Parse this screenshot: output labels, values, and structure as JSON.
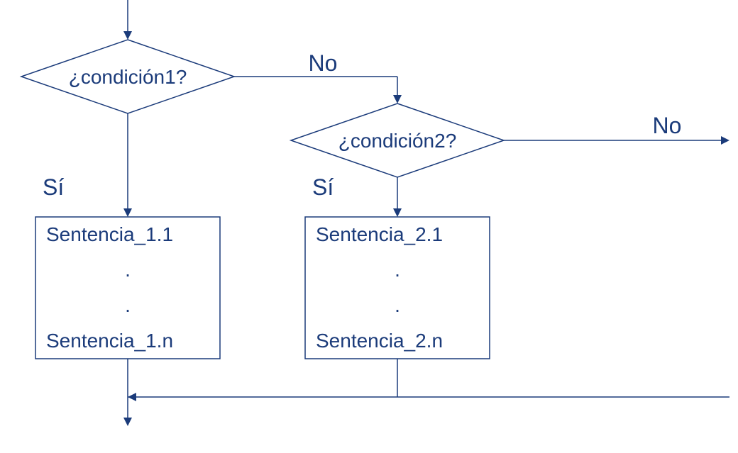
{
  "diagram": {
    "type": "flowchart",
    "decision1": {
      "label": "¿condición1?",
      "yes": "Sí",
      "no": "No"
    },
    "decision2": {
      "label": "¿condición2?",
      "yes": "Sí",
      "no": "No"
    },
    "process1": {
      "line1": "Sentencia_1.1",
      "line2": ".",
      "line3": ".",
      "line4": "Sentencia_1.n"
    },
    "process2": {
      "line1": "Sentencia_2.1",
      "line2": ".",
      "line3": ".",
      "line4": "Sentencia_2.n"
    }
  },
  "chart_data": {
    "type": "flowchart",
    "nodes": [
      {
        "id": "start",
        "type": "start"
      },
      {
        "id": "d1",
        "type": "decision",
        "label": "¿condición1?"
      },
      {
        "id": "d2",
        "type": "decision",
        "label": "¿condición2?"
      },
      {
        "id": "p1",
        "type": "process",
        "lines": [
          "Sentencia_1.1",
          ".",
          ".",
          "Sentencia_1.n"
        ]
      },
      {
        "id": "p2",
        "type": "process",
        "lines": [
          "Sentencia_2.1",
          ".",
          ".",
          "Sentencia_2.n"
        ]
      },
      {
        "id": "end",
        "type": "end"
      }
    ],
    "edges": [
      {
        "from": "start",
        "to": "d1"
      },
      {
        "from": "d1",
        "to": "p1",
        "label": "Sí"
      },
      {
        "from": "d1",
        "to": "d2",
        "label": "No"
      },
      {
        "from": "d2",
        "to": "p2",
        "label": "Sí"
      },
      {
        "from": "d2",
        "to": "offpage",
        "label": "No"
      },
      {
        "from": "p1",
        "to": "end"
      },
      {
        "from": "p2",
        "to": "end"
      }
    ]
  }
}
